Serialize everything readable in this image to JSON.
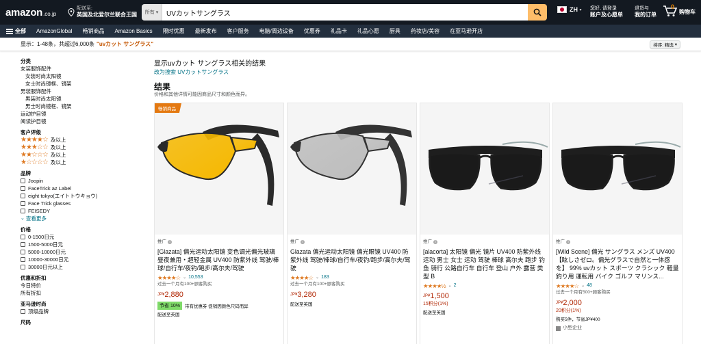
{
  "header": {
    "logo": "amazon",
    "logo_suffix": ".co.jp",
    "deliver_line1": "配送至:",
    "deliver_line2": "英国及北爱尔兰联合王国",
    "search_category": "所有",
    "search_value": "UVカットサングラス",
    "language": "ZH",
    "account_line1": "您好, 请登录",
    "account_line2": "账户及心愿单",
    "orders_line1": "退货与",
    "orders_line2": "我的订单",
    "cart_count": "0",
    "cart_label": "购物车"
  },
  "subnav": {
    "all_label": "全部",
    "items": [
      "AmazonGlobal",
      "畅销商品",
      "Amazon Basics",
      "限时优惠",
      "最新发布",
      "客户服务",
      "电脑/周边设备",
      "优惠券",
      "礼品卡",
      "礼品心愿",
      "厨具",
      "药妆店/美容",
      "在亚马逊开店"
    ]
  },
  "results_bar": {
    "text": "显示：1-48条，共超过6,000条",
    "query": "\"uvカット サングラス\"",
    "sort_label": "排序: 精选"
  },
  "sidebar": {
    "category_heading": "分类",
    "categories": [
      {
        "label": "女装服饰配件",
        "indent": false
      },
      {
        "label": "女装时尚太阳镜",
        "indent": true
      },
      {
        "label": "女士时尚镜框、镜架",
        "indent": true
      },
      {
        "label": "男装服饰配件",
        "indent": false
      },
      {
        "label": "男装时尚太阳镜",
        "indent": true
      },
      {
        "label": "男士时尚镜框、镜架",
        "indent": true
      },
      {
        "label": "运动护目镜",
        "indent": false
      },
      {
        "label": "阅读护目镜",
        "indent": false
      }
    ],
    "rating_heading": "客户评级",
    "ratings": [
      {
        "stars": "★★★★☆",
        "label": "及以上"
      },
      {
        "stars": "★★★☆☆",
        "label": "及以上"
      },
      {
        "stars": "★★☆☆☆",
        "label": "及以上"
      },
      {
        "stars": "★☆☆☆☆",
        "label": "及以上"
      }
    ],
    "brand_heading": "品牌",
    "brands": [
      "Joopin",
      "FaceTrick az Label",
      "eight tokyo(エイトトウキョウ)",
      "Face Trick glasses",
      "FEISEDY"
    ],
    "see_more": "查看更多",
    "price_heading": "价格",
    "prices": [
      "0-1500日元",
      "1500-5000日元",
      "5000-10000日元",
      "10000-30000日元",
      "30000日元以上"
    ],
    "deals_heading": "优惠和折扣",
    "deals": [
      "今日特价",
      "所有折扣"
    ],
    "premium_heading": "亚马逊时尚",
    "premium": [
      "顶级品牌"
    ],
    "size_heading": "尺码"
  },
  "main": {
    "related_title": "显示uvカット サングラス相关的结果",
    "related_link": "改为搜索 UVカットサングラス",
    "results_heading": "结果",
    "results_sub": "价格和其他详情可能因商品尺寸和颜色而异。"
  },
  "products": [
    {
      "badge": "畅销商品",
      "sponsored": "推广",
      "title": "[Glazata] 偏光运动太阳镜 变色调光偏光玻璃 昼夜兼用・超轻金属 UV400 防紫外线 驾驶/棒球/自行车/夜钓/跑步/高尔夫/驾驶",
      "stars": "★★★★☆",
      "rating_count": "10,553",
      "bought": "过去一个月有100+顾客购买",
      "price_currency": "JP¥",
      "price": "2,880",
      "points": "",
      "deal_tag": "节省 10%",
      "deal_text": "带有优惠券 促销因颜色尺码而异",
      "shipping": "配送至英国",
      "extra": "",
      "lens_color": "#f5b800",
      "frame_color": "#2a2a2a"
    },
    {
      "badge": "",
      "sponsored": "推广",
      "title": "Glazata 偏光运动太阳镜 偏光眼镜 UV400 防紫外线 驾驶/棒球/自行车/夜钓/跑步/高尔夫/驾驶",
      "stars": "★★★★☆",
      "rating_count": "183",
      "bought": "过去一个月有100+顾客购买",
      "price_currency": "JP¥",
      "price": "3,280",
      "points": "",
      "deal_tag": "",
      "deal_text": "",
      "shipping": "配送至英国",
      "extra": "",
      "lens_color": "#bdbdbd",
      "frame_color": "#333333"
    },
    {
      "badge": "",
      "sponsored": "推广",
      "title": "[alacorta] 太阳镜 偏光 镜片 UV400 防紫外线 运动 男士 女士 运动 驾驶 棒球 高尔夫 跑步 钓鱼 骑行 公路自行车 自行车 登山 户外 露营 类型 B",
      "stars": "★★★★½",
      "rating_count": "2",
      "bought": "",
      "price_currency": "JP¥",
      "price": "1,500",
      "points": "15积分(1%)",
      "deal_tag": "",
      "deal_text": "",
      "shipping": "配送至英国",
      "extra": "",
      "lens_color": "#1a1a1a",
      "frame_color": "#1e1e1e"
    },
    {
      "badge": "",
      "sponsored": "推广",
      "title": "[Wild Scene] 偏光 サングラス メンズ UV400 【眩しさゼロ。偏光グラスで自然と一体感を】 99% uvカット スポーツ クラシック 軽量 釣り用 運転用 バイク ゴルフ マリンス...",
      "stars": "★★★★☆",
      "rating_count": "48",
      "bought": "过去一个月有500+顾客购买",
      "price_currency": "JP¥",
      "price": "2,000",
      "points": "20积分(1%)",
      "deal_tag": "",
      "deal_text": "",
      "shipping": "购买5件，节省JP¥400",
      "extra": "小型企业",
      "lens_color": "#1a1a1a",
      "frame_color": "#1e1e1e"
    }
  ],
  "colors": {
    "nav_bg": "#131921",
    "subnav_bg": "#232f3e",
    "search_btn": "#febd69",
    "link": "#007185",
    "price": "#b12704",
    "star": "#de7921",
    "badge": "#e47911"
  }
}
